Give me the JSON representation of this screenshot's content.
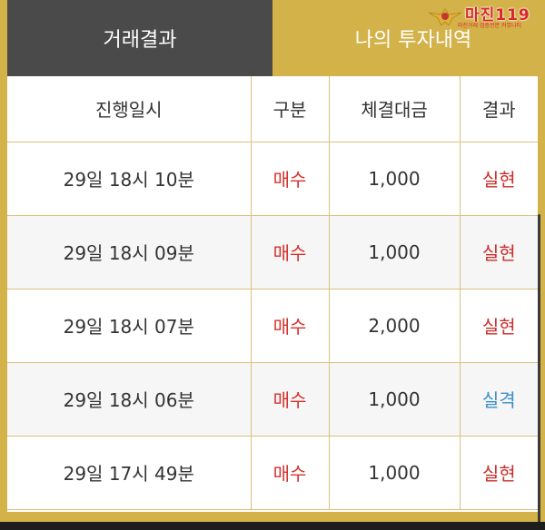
{
  "tabs": [
    {
      "label": "거래결과",
      "active": false
    },
    {
      "label": "나의 투자내역",
      "active": true
    }
  ],
  "watermark": {
    "main": "마진119",
    "sub": "마진거래 검증전문 커뮤니티",
    "icon": "eagle-emblem-icon"
  },
  "table": {
    "headers": [
      "진행일시",
      "구분",
      "체결대금",
      "결과"
    ],
    "rows": [
      {
        "time": "29일 18시 10분",
        "type": "매수",
        "amount": "1,000",
        "result": "실현",
        "outcome": "win"
      },
      {
        "time": "29일 18시 09분",
        "type": "매수",
        "amount": "1,000",
        "result": "실현",
        "outcome": "win"
      },
      {
        "time": "29일 18시 07분",
        "type": "매수",
        "amount": "2,000",
        "result": "실현",
        "outcome": "win"
      },
      {
        "time": "29일 18시 06분",
        "type": "매수",
        "amount": "1,000",
        "result": "실격",
        "outcome": "lose"
      },
      {
        "time": "29일 17시 49분",
        "type": "매수",
        "amount": "1,000",
        "result": "실현",
        "outcome": "win"
      }
    ]
  },
  "colors": {
    "accent": "#d4b24a",
    "tab_inactive": "#4a4a4a",
    "buy": "#d6322d",
    "win": "#c92f2a",
    "lose": "#3c8fc9"
  }
}
